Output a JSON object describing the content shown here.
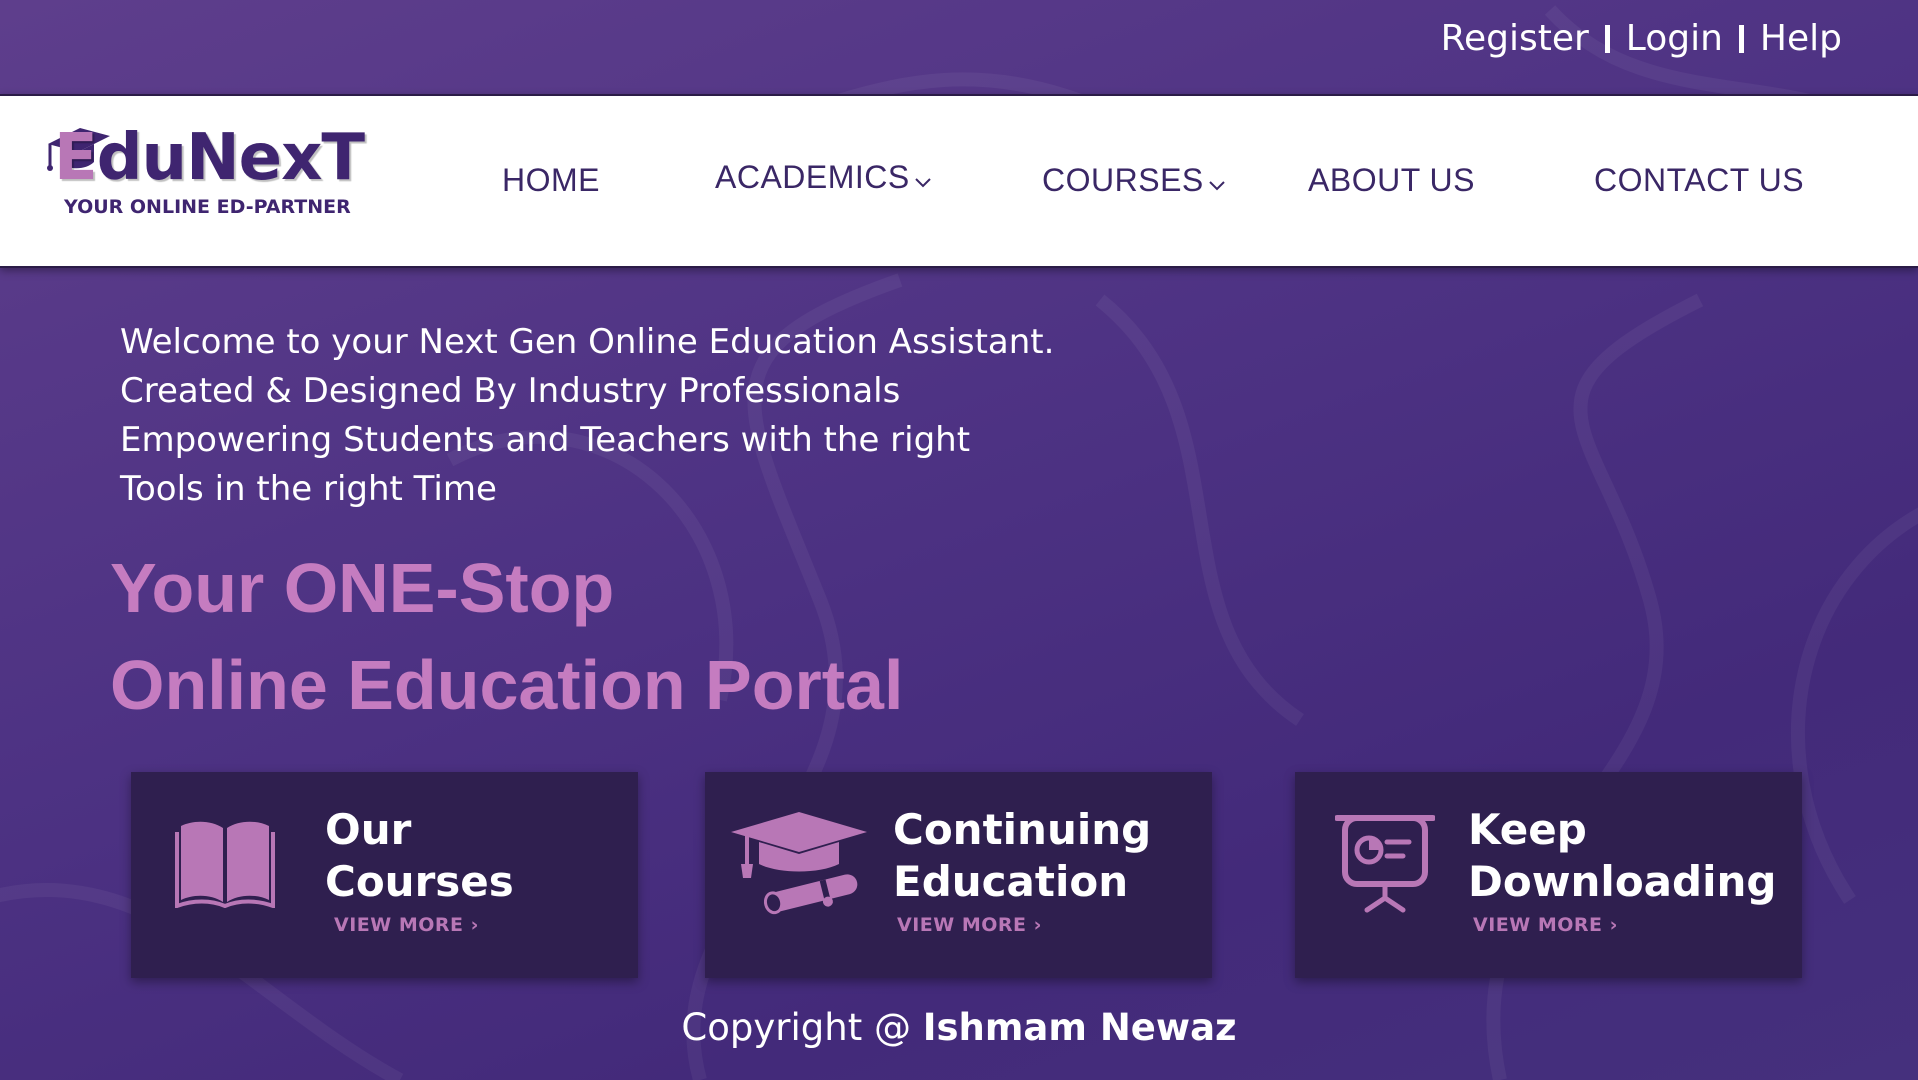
{
  "header": {
    "links": [
      "Register",
      "Login",
      "Help"
    ]
  },
  "logo": {
    "name_first": "E",
    "name_rest": "duNexT",
    "tagline": "YOUR ONLINE ED-PARTNER"
  },
  "nav": {
    "home": "HOME",
    "academics": "ACADEMICS",
    "courses": "COURSES",
    "about": "ABOUT US",
    "contact": "CONTACT US"
  },
  "intro": {
    "lines": [
      "Welcome to your Next Gen Online Education Assistant.",
      "Created & Designed By Industry Professionals",
      "Empowering Students and Teachers with the right",
      "Tools in the right Time"
    ]
  },
  "headline": {
    "line1": "Your ONE-Stop",
    "line2": "Online Education Portal"
  },
  "cards": [
    {
      "title_line1": "Our",
      "title_line2": "Courses",
      "more": "VIEW MORE",
      "icon": "book-icon"
    },
    {
      "title_line1": "Continuing",
      "title_line2": "Education",
      "more": "VIEW MORE",
      "icon": "graduation-cap-icon"
    },
    {
      "title_line1": "Keep",
      "title_line2": "Downloading",
      "more": "VIEW MORE",
      "icon": "presentation-board-icon"
    }
  ],
  "footer": {
    "prefix": "Copyright @ ",
    "author": "Ishmam Newaz"
  },
  "colors": {
    "background": "#4d3283",
    "accent_pink": "#c57cc0",
    "nav_text": "#3a2766",
    "card_bg": "#2f1f4f"
  }
}
